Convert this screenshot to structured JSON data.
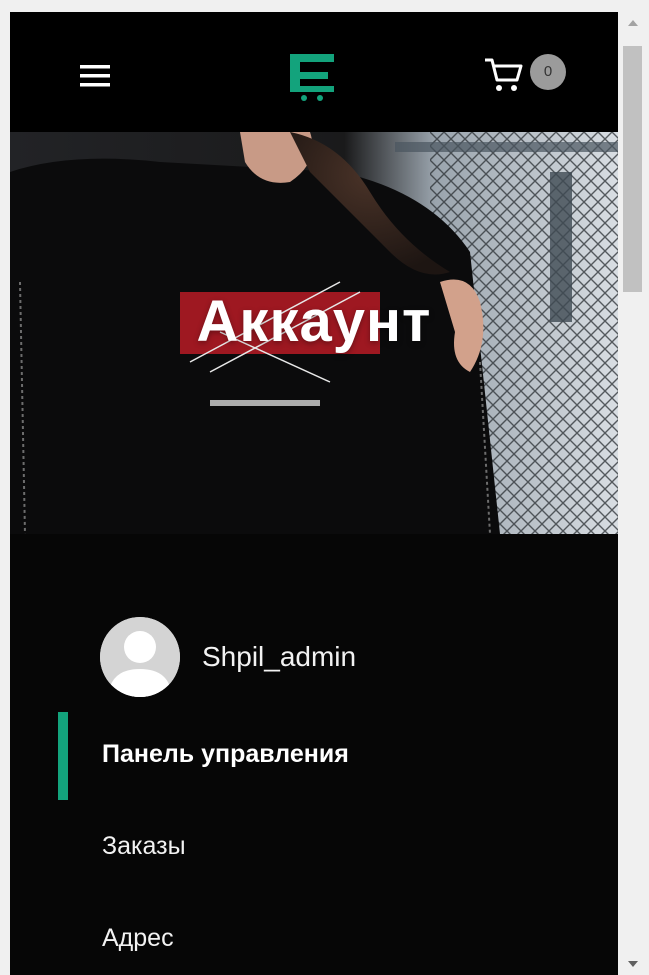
{
  "header": {
    "menu_icon": "hamburger-menu-icon",
    "logo_icon": "cart-e-logo-icon",
    "cart_icon": "shopping-cart-icon",
    "cart_count": "0"
  },
  "hero": {
    "title": "Аккаунт"
  },
  "account": {
    "avatar_icon": "user-avatar-icon",
    "username": "Shpil_admin",
    "nav": [
      {
        "label": "Панель управления",
        "active": true
      },
      {
        "label": "Заказы",
        "active": false
      },
      {
        "label": "Адрес",
        "active": false
      }
    ]
  },
  "colors": {
    "accent": "#13a37c",
    "background": "#060606",
    "badge": "#9b9b9b"
  }
}
